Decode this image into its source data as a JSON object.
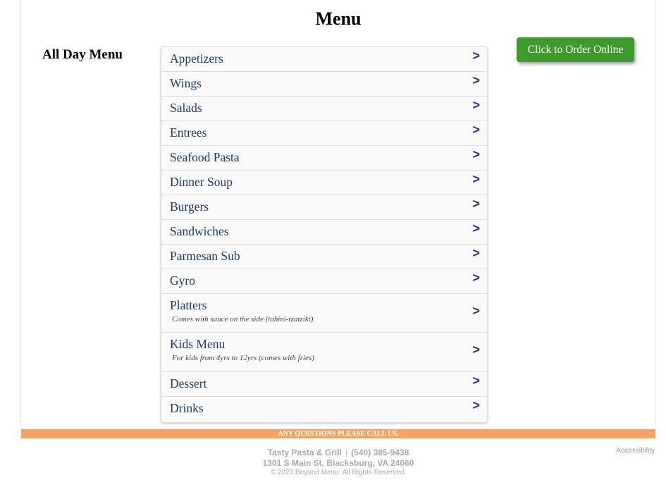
{
  "page": {
    "title": "Menu",
    "section_label": "All Day Menu",
    "order_button_label": "Click to Order Online"
  },
  "categories": [
    {
      "name": "Appetizers",
      "note": ""
    },
    {
      "name": "Wings",
      "note": ""
    },
    {
      "name": "Salads",
      "note": ""
    },
    {
      "name": "Entrees",
      "note": ""
    },
    {
      "name": "Seafood Pasta",
      "note": ""
    },
    {
      "name": "Dinner Soup",
      "note": ""
    },
    {
      "name": "Burgers",
      "note": ""
    },
    {
      "name": "Sandwiches",
      "note": ""
    },
    {
      "name": "Parmesan Sub",
      "note": ""
    },
    {
      "name": "Gyro",
      "note": ""
    },
    {
      "name": "Platters",
      "note": "Comes with sauce on the side (tahini-tzatziki)"
    },
    {
      "name": "Kids Menu",
      "note": "For kids from 4yrs to 12yrs (comes with fries)"
    },
    {
      "name": "Dessert",
      "note": ""
    },
    {
      "name": "Drinks",
      "note": ""
    }
  ],
  "chevron": ">",
  "banner": {
    "text": "ANY QUESTIONS PLEASE CALL US."
  },
  "footer": {
    "restaurant": "Tasty Pasta & Grill",
    "separator": "|",
    "phone": "(540) 385-9438",
    "address": "1301 S Main St, Blacksburg, VA 24060",
    "copyright": "© 2023 Beyond Menu. All Rights Reserved.",
    "accessibility": "Accessibility"
  },
  "colors": {
    "order_button": "#3e9a2c",
    "banner": "#f4a460",
    "link": "#1f3a6e"
  }
}
